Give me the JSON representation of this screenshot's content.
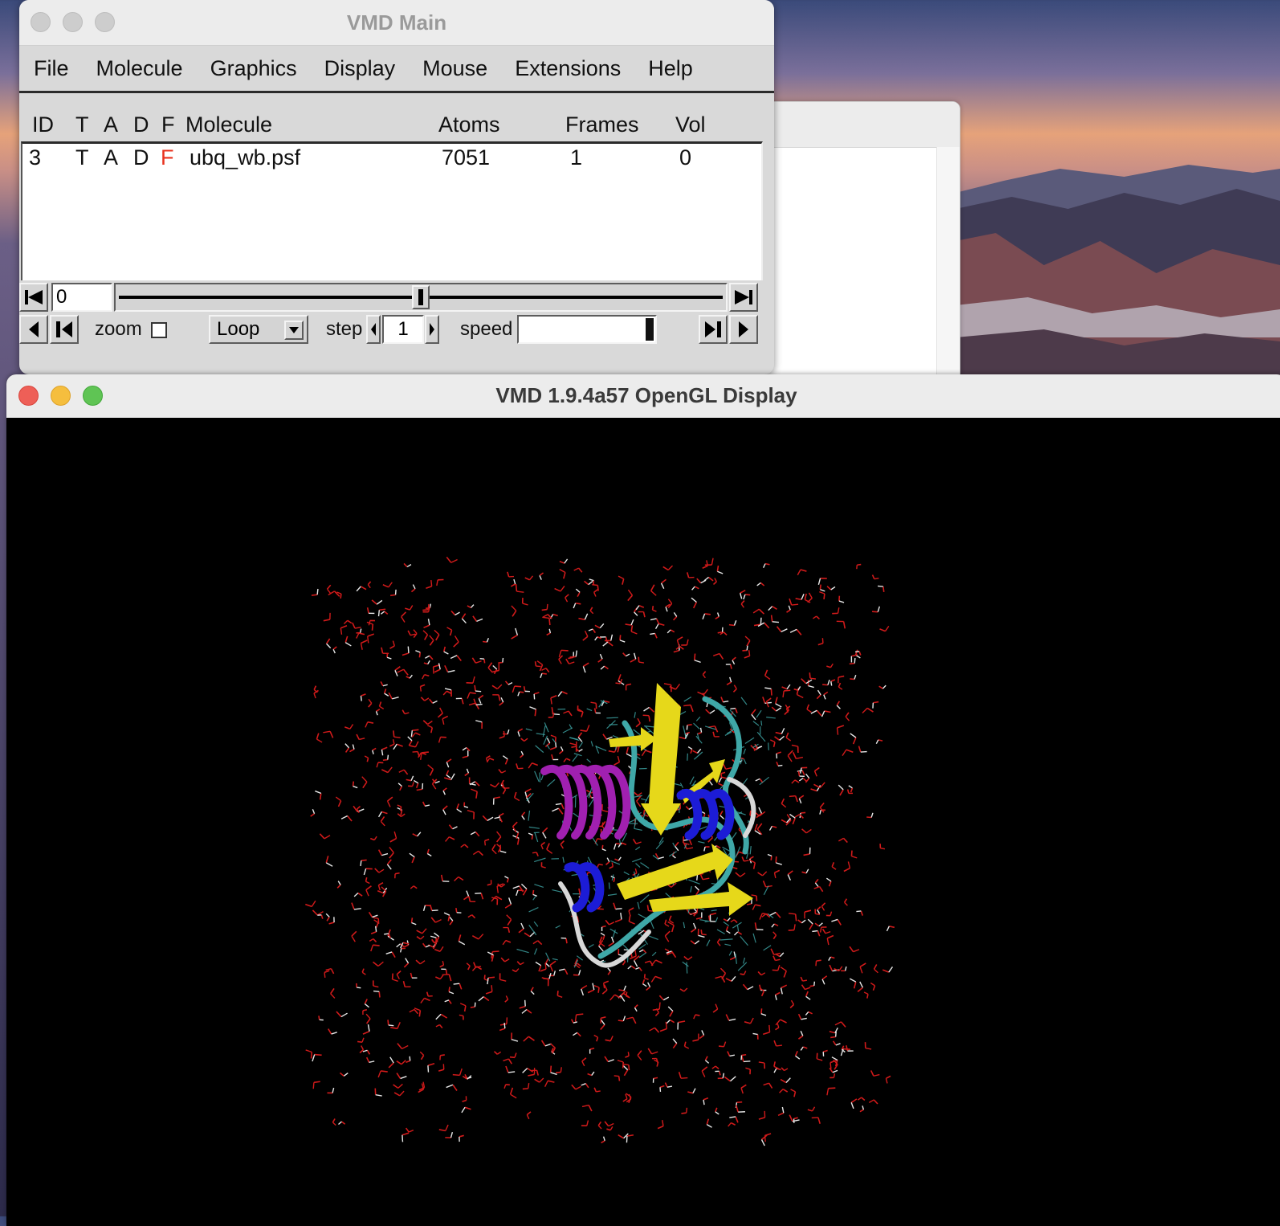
{
  "main_window": {
    "title": "VMD Main",
    "menu": [
      "File",
      "Molecule",
      "Graphics",
      "Display",
      "Mouse",
      "Extensions",
      "Help"
    ],
    "columns": {
      "id": "ID",
      "t": "T",
      "a": "A",
      "d": "D",
      "f": "F",
      "molecule": "Molecule",
      "atoms": "Atoms",
      "frames": "Frames",
      "vol": "Vol"
    },
    "molecules": [
      {
        "id": "3",
        "t": "T",
        "a": "A",
        "d": "D",
        "f": "F",
        "name": "ubq_wb.psf",
        "atoms": "7051",
        "frames": "1",
        "vol": "0"
      }
    ],
    "frame_value": "0",
    "frame_slider_fraction": 0.5,
    "zoom_label": "zoom",
    "zoom_checked": false,
    "loop_mode": "Loop",
    "step_label": "step",
    "step_value": "1",
    "speed_label": "speed",
    "speed_fraction": 1.0
  },
  "display_window": {
    "title": "VMD 1.9.4a57 OpenGL Display"
  },
  "colors": {
    "f_flag": "#e8321e",
    "water_oxygen": "#d11a1a",
    "water_hydrogen": "#e8e8e8",
    "helix_alpha": "#a020b0",
    "helix_310": "#1c1cd6",
    "beta_sheet": "#e6d81a",
    "coil": "#3fa8a8",
    "turn": "#d8d8d8"
  }
}
